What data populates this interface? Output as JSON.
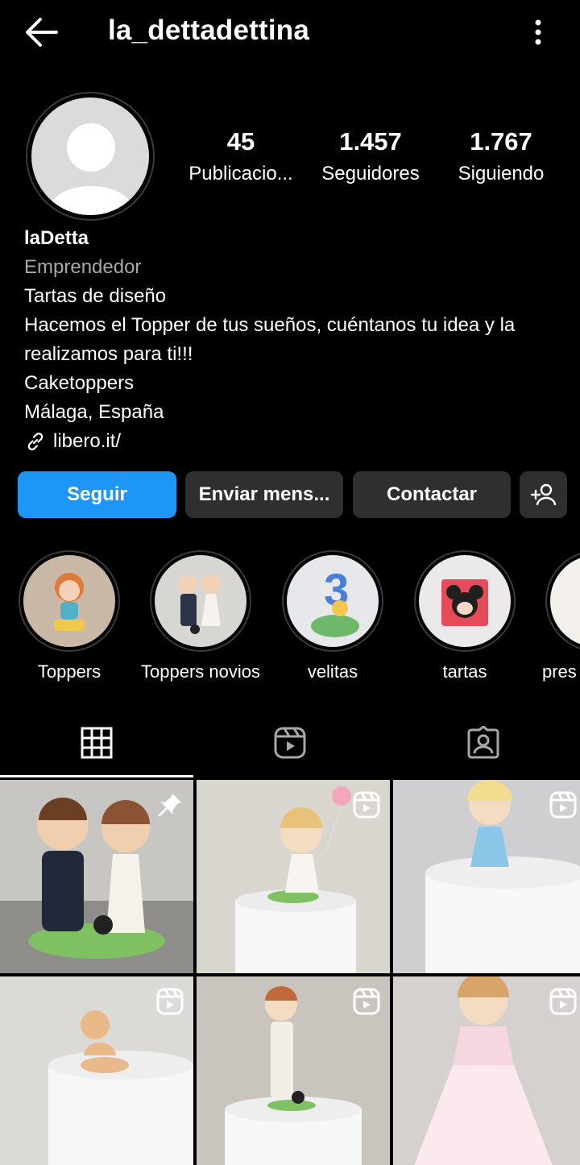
{
  "header": {
    "username": "la_dettadettina",
    "back_icon": "arrow-left-icon",
    "menu_icon": "more-vertical-icon"
  },
  "profile": {
    "stats": [
      {
        "value": "45",
        "label": "Publicacio..."
      },
      {
        "value": "1.457",
        "label": "Seguidores"
      },
      {
        "value": "1.767",
        "label": "Siguiendo"
      }
    ],
    "display_name": "laDetta",
    "category": "Emprendedor",
    "bio_lines": [
      "Tartas de diseño",
      "Hacemos el Topper de tus sueños, cuéntanos tu idea y la realizamos para ti!!!",
      "Caketoppers",
      "Málaga, España"
    ],
    "link": "libero.it/"
  },
  "actions": {
    "follow": "Seguir",
    "message": "Enviar mens...",
    "contact": "Contactar"
  },
  "highlights": [
    {
      "label": "Toppers",
      "color": "#c9b8a6"
    },
    {
      "label": "Toppers novios",
      "color": "#d8d6d2"
    },
    {
      "label": "velitas",
      "color": "#e6e8ec"
    },
    {
      "label": "tartas",
      "color": "#ece9ea"
    },
    {
      "label": "pres",
      "color": "#f3f0ec"
    }
  ],
  "tabs": {
    "grid_icon": "grid-icon",
    "reels_icon": "reels-icon",
    "tagged_icon": "tagged-user-icon"
  },
  "posts": [
    {
      "type": "pinned",
      "color": "#c7c6c3"
    },
    {
      "type": "reel",
      "color": "#d9d6d0"
    },
    {
      "type": "reel",
      "color": "#cfcfd1"
    },
    {
      "type": "reel",
      "color": "#dcdad6"
    },
    {
      "type": "reel",
      "color": "#c9c4bd"
    },
    {
      "type": "reel",
      "color": "#d4d1cf"
    }
  ]
}
